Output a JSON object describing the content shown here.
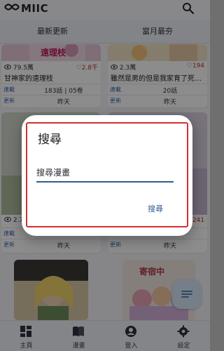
{
  "app": {
    "logo_text": "MIIC"
  },
  "tabs": [
    {
      "label": "最新更新"
    },
    {
      "label": "當月最夯"
    }
  ],
  "cards": [
    {
      "title": "甘神家的遠理枝",
      "cover_text": "遠理枝",
      "views": "79.5萬",
      "likes": "2.8千",
      "meta": [
        {
          "tag": "連載",
          "value": "183話 | 05卷"
        },
        {
          "tag": "更新",
          "value": "昨天"
        }
      ]
    },
    {
      "title": "雖然是男的但是我家育了死…",
      "views": "2.3萬",
      "likes": "194",
      "meta": [
        {
          "tag": "連載",
          "value": "20話"
        },
        {
          "tag": "更新",
          "value": "昨天"
        }
      ]
    },
    {
      "title": "",
      "views": "2.7",
      "likes": "",
      "meta": [
        {
          "tag": "連載",
          "value": ""
        },
        {
          "tag": "更新",
          "value": "昨天"
        }
      ]
    },
    {
      "title": "",
      "views": "",
      "likes": "241",
      "meta": [
        {
          "tag": "連載",
          "value": ""
        },
        {
          "tag": "更新",
          "value": "昨天"
        }
      ]
    },
    {
      "title": "",
      "cover_text": "",
      "views": "",
      "likes": "",
      "meta": []
    },
    {
      "title": "",
      "cover_text": "寄宿中",
      "views": "",
      "likes": "",
      "meta": []
    }
  ],
  "dialog": {
    "title": "搜尋",
    "input_placeholder": "搜尋漫畫",
    "action_label": "搜尋"
  },
  "bottom_nav": [
    {
      "label": "主頁",
      "icon": "home-grid-icon"
    },
    {
      "label": "漫畫",
      "icon": "book-icon"
    },
    {
      "label": "登入",
      "icon": "person-icon"
    },
    {
      "label": "設定",
      "icon": "gear-icon"
    }
  ],
  "colors": {
    "accent": "#2f5d94",
    "highlight_frame": "#d32f2f",
    "like": "#b33333"
  }
}
